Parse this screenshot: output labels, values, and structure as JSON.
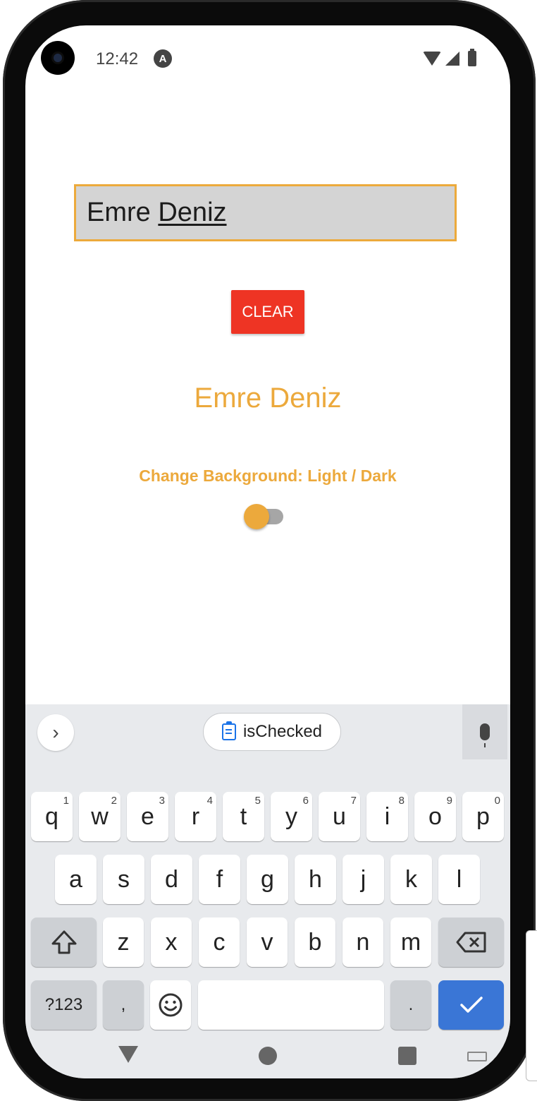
{
  "status_bar": {
    "time": "12:42",
    "notification_icon": "A"
  },
  "app": {
    "input_value_plain": "Emre ",
    "input_value_underlined": "Deniz",
    "clear_label": "CLEAR",
    "display_name": "Emre Deniz",
    "bg_toggle_label": "Change Background: Light / Dark",
    "switch_on": false
  },
  "keyboard": {
    "suggestion": "isChecked",
    "row1": [
      {
        "k": "q",
        "h": "1"
      },
      {
        "k": "w",
        "h": "2"
      },
      {
        "k": "e",
        "h": "3"
      },
      {
        "k": "r",
        "h": "4"
      },
      {
        "k": "t",
        "h": "5"
      },
      {
        "k": "y",
        "h": "6"
      },
      {
        "k": "u",
        "h": "7"
      },
      {
        "k": "i",
        "h": "8"
      },
      {
        "k": "o",
        "h": "9"
      },
      {
        "k": "p",
        "h": "0"
      }
    ],
    "row2": [
      "a",
      "s",
      "d",
      "f",
      "g",
      "h",
      "j",
      "k",
      "l"
    ],
    "row3": [
      "z",
      "x",
      "c",
      "v",
      "b",
      "n",
      "m"
    ],
    "symbols_label": "?123",
    "comma_label": ",",
    "period_label": "."
  },
  "colors": {
    "accent": "#eca93c",
    "clear_button": "#ee3424",
    "keyboard_action": "#3a76d6"
  }
}
